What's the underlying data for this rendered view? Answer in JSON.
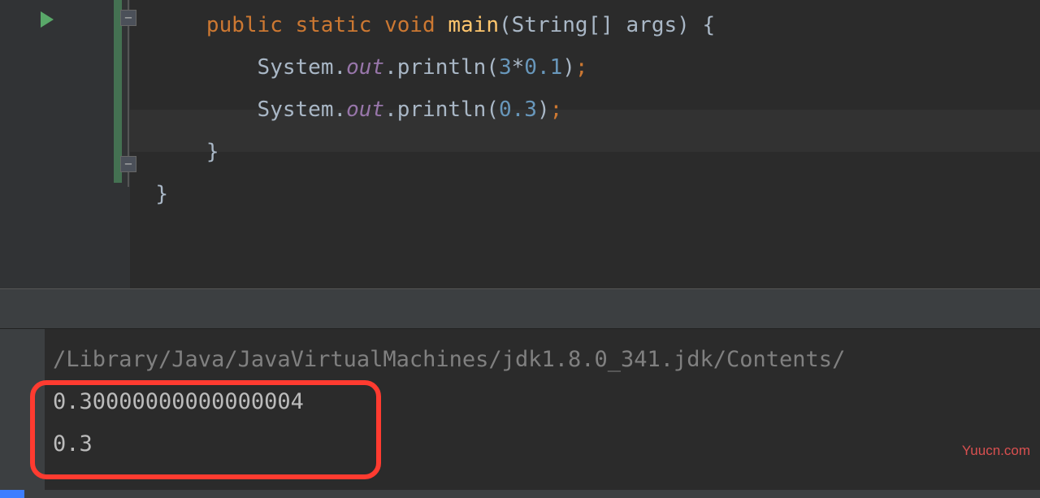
{
  "code": {
    "line1": {
      "indent": "      ",
      "kw_public": "public",
      "kw_static": "static",
      "kw_void": "void",
      "method_name": "main",
      "param_type": "String",
      "brackets": "[]",
      "param_name": "args",
      "open_paren": "(",
      "close_paren": ")",
      "open_brace": " {"
    },
    "line2": {
      "indent": "          ",
      "class": "System",
      "dot1": ".",
      "field": "out",
      "dot2": ".",
      "method": "println",
      "open_paren": "(",
      "arg_a": "3",
      "op": "*",
      "arg_b": "0.1",
      "close_paren": ")",
      "semi": ";"
    },
    "line3": {
      "indent": "          ",
      "class": "System",
      "dot1": ".",
      "field": "out",
      "dot2": ".",
      "method": "println",
      "open_paren": "(",
      "arg": "0.3",
      "close_paren": ")",
      "semi": ";"
    },
    "line4": {
      "indent": "      ",
      "close_brace": "}"
    },
    "line5": {
      "indent": "  ",
      "close_brace": "}"
    }
  },
  "terminal": {
    "path": "/Library/Java/JavaVirtualMachines/jdk1.8.0_341.jdk/Contents/",
    "output1": "0.30000000000000004",
    "output2": "0.3"
  },
  "watermark": "Yuucn.com"
}
